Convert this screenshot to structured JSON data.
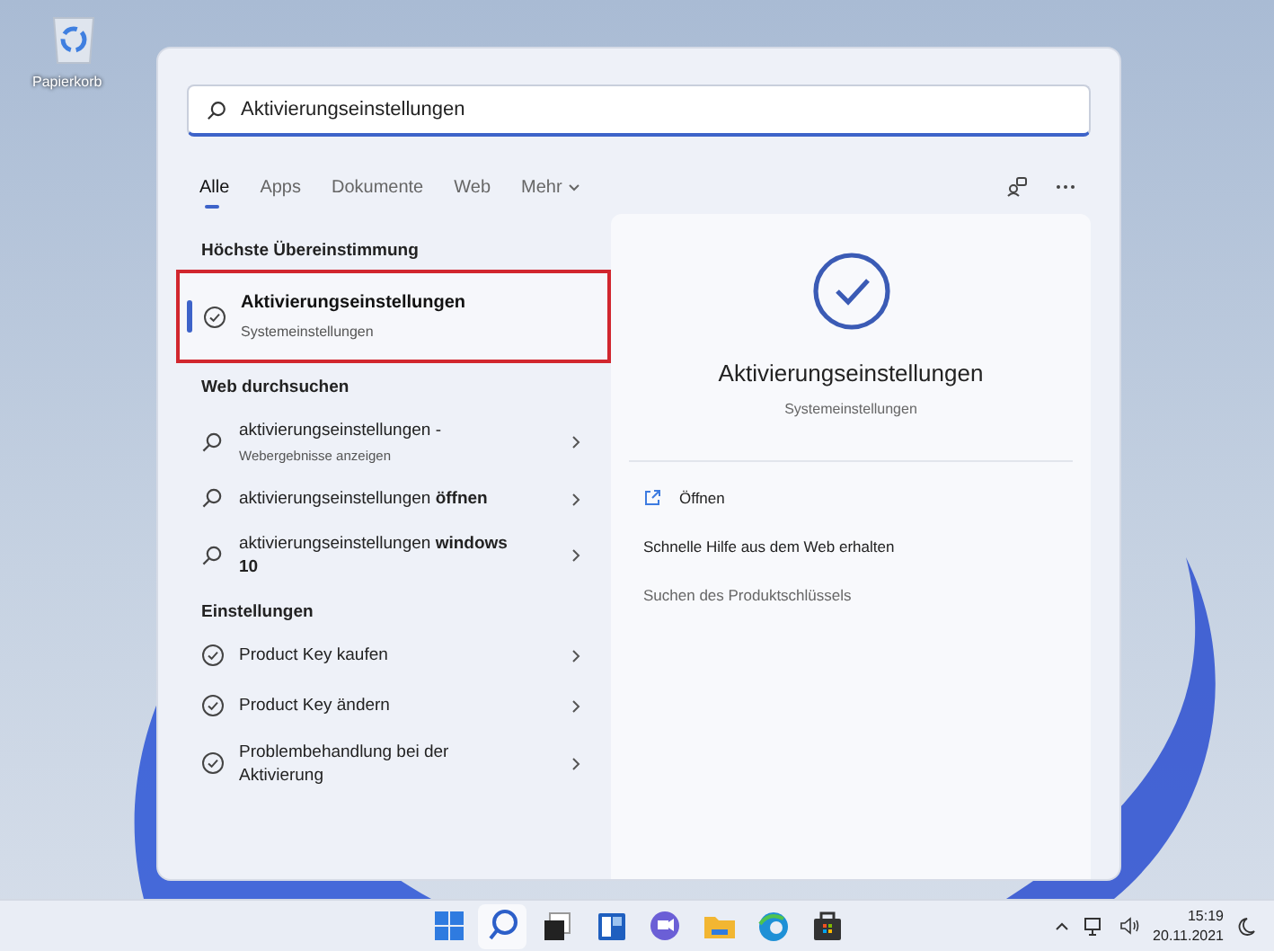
{
  "desktop_icons": [
    {
      "label": "Papierkorb"
    }
  ],
  "search": {
    "value": "Aktivierungseinstellungen"
  },
  "tabs": [
    {
      "label": "Alle",
      "selected": true,
      "kind": "plain"
    },
    {
      "label": "Apps",
      "selected": false,
      "kind": "plain"
    },
    {
      "label": "Dokumente",
      "selected": false,
      "kind": "plain"
    },
    {
      "label": "Web",
      "selected": false,
      "kind": "plain"
    },
    {
      "label": "Mehr",
      "selected": false,
      "kind": "menu"
    }
  ],
  "best_match": {
    "heading": "Höchste Übereinstimmung",
    "items": [
      {
        "title": "Aktivierungseinstellungen",
        "subtitle": "Systemeinstellungen",
        "selected": true,
        "outlined": true
      }
    ]
  },
  "web_search": {
    "heading": "Web durchsuchen",
    "items": [
      {
        "text": "aktivierungseinstellungen -",
        "subtitle": "Webergebnisse anzeigen"
      },
      {
        "text": "aktivierungseinstellungen **öffnen**"
      },
      {
        "text": "aktivierungseinstellungen **windows 10**"
      }
    ]
  },
  "settings": {
    "heading": "Einstellungen",
    "items": [
      {
        "text": "Product Key kaufen"
      },
      {
        "text": "Product Key ändern"
      },
      {
        "text": "Problembehandlung bei der Aktivierung"
      }
    ]
  },
  "preview": {
    "title": "Aktivierungseinstellungen",
    "subtitle": "Systemeinstellungen",
    "actions": [
      {
        "label": "Öffnen",
        "kind": "open"
      },
      {
        "label": "Schnelle Hilfe aus dem Web erhalten",
        "kind": "link"
      },
      {
        "label": "Suchen des Produktschlüssels",
        "kind": "muted"
      }
    ]
  },
  "taskbar": {
    "apps": [
      {
        "kind": "start",
        "selected": false
      },
      {
        "kind": "search",
        "selected": true
      },
      {
        "kind": "taskview",
        "selected": false
      },
      {
        "kind": "widgets",
        "selected": false
      },
      {
        "kind": "chat",
        "selected": false
      },
      {
        "kind": "explorer",
        "selected": false
      },
      {
        "kind": "edge",
        "selected": false
      },
      {
        "kind": "store",
        "selected": false
      }
    ],
    "time": "15:19",
    "date": "20.11.2021"
  }
}
